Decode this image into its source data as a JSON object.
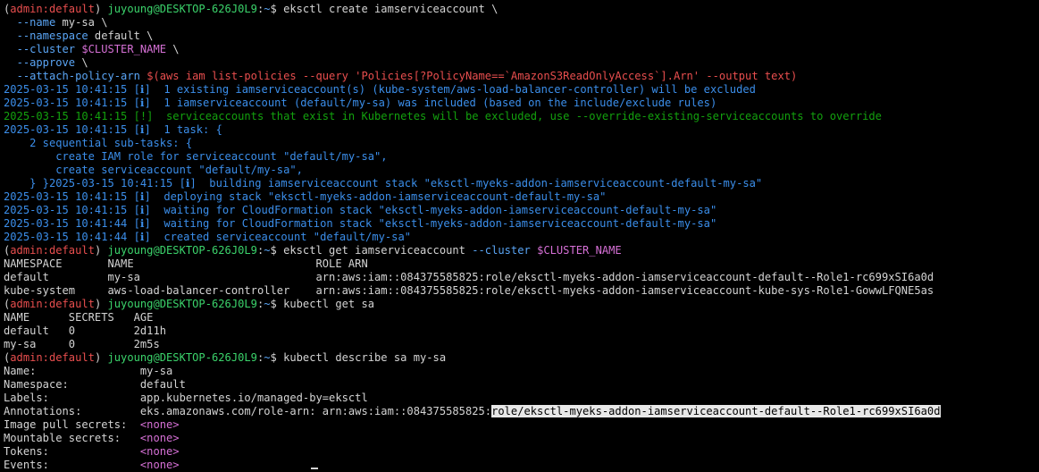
{
  "prompt": {
    "env": "admin:default",
    "user_host": "juyoung@DESKTOP-626J0L9",
    "path": "~"
  },
  "cmd1": {
    "line1": "eksctl create iamserviceaccount \\",
    "name_flag": "--name",
    "name_val": " my-sa \\",
    "ns_flag": "--namespace",
    "ns_val": " default \\",
    "cluster_flag": "--cluster",
    "cluster_var": "$CLUSTER_NAME",
    "cluster_tail": " \\",
    "approve_flag": "--approve",
    "approve_tail": " \\",
    "policy_flag": "--attach-policy-arn",
    "policy_val": "$(aws iam list-policies --query 'Policies[?PolicyName==`AmazonS3ReadOnlyAccess`].Arn' --output text)"
  },
  "log": {
    "l1_ts": "2025-03-15 10:41:15 [ℹ]",
    "l1_msg": "  1 existing iamserviceaccount(s) (kube-system/aws-load-balancer-controller) will be excluded",
    "l2_ts": "2025-03-15 10:41:15 [ℹ]",
    "l2_msg": "  1 iamserviceaccount (default/my-sa) was included (based on the include/exclude rules)",
    "l3_ts": "2025-03-15 10:41:15 [!]",
    "l3_msg": "  serviceaccounts that exist in Kubernetes will be excluded, use --override-existing-serviceaccounts to override",
    "l4_ts": "2025-03-15 10:41:15 [ℹ]",
    "l4_msg": "  1 task: {",
    "l5": "    2 sequential sub-tasks: {",
    "l6": "        create IAM role for serviceaccount \"default/my-sa\",",
    "l7": "        create serviceaccount \"default/my-sa\",",
    "l8_pre": "    } }",
    "l8_ts": "2025-03-15 10:41:15 [ℹ]",
    "l8_msg": "  building iamserviceaccount stack \"eksctl-myeks-addon-iamserviceaccount-default-my-sa\"",
    "l9_ts": "2025-03-15 10:41:15 [ℹ]",
    "l9_msg": "  deploying stack \"eksctl-myeks-addon-iamserviceaccount-default-my-sa\"",
    "l10_ts": "2025-03-15 10:41:15 [ℹ]",
    "l10_msg": "  waiting for CloudFormation stack \"eksctl-myeks-addon-iamserviceaccount-default-my-sa\"",
    "l11_ts": "2025-03-15 10:41:44 [ℹ]",
    "l11_msg": "  waiting for CloudFormation stack \"eksctl-myeks-addon-iamserviceaccount-default-my-sa\"",
    "l12_ts": "2025-03-15 10:41:44 [ℹ]",
    "l12_msg": "  created serviceaccount \"default/my-sa\""
  },
  "cmd2": {
    "text": "eksctl get iamserviceaccount ",
    "flag": "--cluster",
    "var": "$CLUSTER_NAME"
  },
  "table_isa": {
    "header": "NAMESPACE       NAME                            ROLE ARN",
    "row1": "default         my-sa                           arn:aws:iam::084375585825:role/eksctl-myeks-addon-iamserviceaccount-default--Role1-rc699xSI6a0d",
    "row2": "kube-system     aws-load-balancer-controller    arn:aws:iam::084375585825:role/eksctl-myeks-addon-iamserviceaccount-kube-sys-Role1-GowwLFQNE5as"
  },
  "cmd3": {
    "text": "kubectl get sa"
  },
  "table_sa": {
    "header": "NAME      SECRETS   AGE",
    "row1": "default   0         2d11h",
    "row2": "my-sa     0         2m5s"
  },
  "cmd4": {
    "text": "kubectl describe sa my-sa"
  },
  "describe": {
    "name_k": "Name:                ",
    "name_v": "my-sa",
    "ns_k": "Namespace:           ",
    "ns_v": "default",
    "labels_k": "Labels:              ",
    "labels_v": "app.kubernetes.io/managed-by=eksctl",
    "ann_k": "Annotations:         ",
    "ann_v": "eks.amazonaws.com/role-arn: arn:aws:iam::084375585825:",
    "ann_sel": "role/eksctl-myeks-addon-iamserviceaccount-default--Role1-rc699xSI6a0d",
    "ips_k": "Image pull secrets:  ",
    "ms_k": "Mountable secrets:   ",
    "tok_k": "Tokens:              ",
    "ev_k": "Events:              ",
    "none": "<none>"
  }
}
